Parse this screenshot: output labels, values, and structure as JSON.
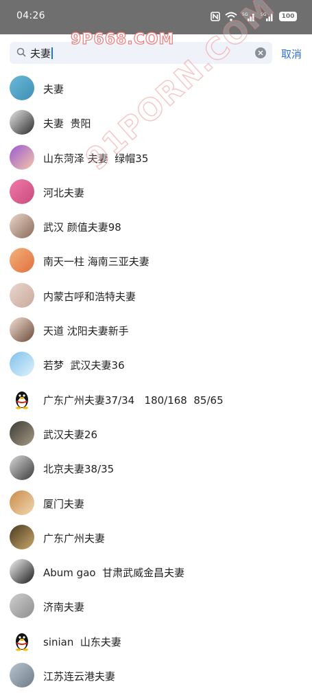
{
  "status_bar": {
    "time": "04:26",
    "battery": "100"
  },
  "watermarks": {
    "top": "9P668.COM",
    "diagonal": "91PORN.COM"
  },
  "search": {
    "query": "夫妻",
    "cancel_label": "取消"
  },
  "results": [
    {
      "name": "夫妻",
      "avatar": "photo-sea",
      "colors": [
        "#6ab9d8",
        "#3f8fb5"
      ]
    },
    {
      "name": "夫妻  贵阳",
      "avatar": "photo-dark",
      "colors": [
        "#e6e6e6",
        "#2b2b2b"
      ]
    },
    {
      "name": "山东菏泽 夫妻  绿帽35",
      "avatar": "photo-cartoon",
      "colors": [
        "#9b59d0",
        "#f4c7a8"
      ]
    },
    {
      "name": "河北夫妻",
      "avatar": "photo-pink",
      "colors": [
        "#f07aa8",
        "#c94b7d"
      ]
    },
    {
      "name": "武汉 颜值夫妻98",
      "avatar": "photo-face",
      "colors": [
        "#e9d6c8",
        "#8a6a58"
      ]
    },
    {
      "name": "南天一柱 海南三亚夫妻",
      "avatar": "photo-fingers",
      "colors": [
        "#f3b27a",
        "#e07040"
      ]
    },
    {
      "name": "内蒙古呼和浩特夫妻",
      "avatar": "photo-skin",
      "colors": [
        "#ead6cf",
        "#c9a89a"
      ]
    },
    {
      "name": "天道 沈阳夫妻新手",
      "avatar": "photo-girl",
      "colors": [
        "#f2e0d4",
        "#6b4a3a"
      ]
    },
    {
      "name": "若梦  武汉夫妻36",
      "avatar": "photo-sky",
      "colors": [
        "#7fc2ec",
        "#dff1fb"
      ]
    },
    {
      "name": "广东广州夫妻37/34   180/168  85/65",
      "avatar": "penguin-icon",
      "colors": [
        "#ffffff",
        "#111111"
      ]
    },
    {
      "name": "武汉夫妻26",
      "avatar": "photo-hair",
      "colors": [
        "#3b3b34",
        "#a89a86"
      ]
    },
    {
      "name": "北京夫妻38/35",
      "avatar": "photo-bw",
      "colors": [
        "#d9d9d9",
        "#3a3a3a"
      ]
    },
    {
      "name": "厦门夫妻",
      "avatar": "photo-dog",
      "colors": [
        "#c98a4a",
        "#f1d8b0"
      ]
    },
    {
      "name": "广东广州夫妻",
      "avatar": "photo-gold",
      "colors": [
        "#4a3a22",
        "#caa86a"
      ]
    },
    {
      "name": "Abum gao  甘肃武威金昌夫妻",
      "avatar": "photo-panda",
      "colors": [
        "#f4f4f4",
        "#1a1a1a"
      ]
    },
    {
      "name": "济南夫妻",
      "avatar": "photo-phone",
      "colors": [
        "#cfcfcf",
        "#8d8d8d"
      ]
    },
    {
      "name": "sinian  山东夫妻",
      "avatar": "penguin-icon",
      "colors": [
        "#ffffff",
        "#111111"
      ]
    },
    {
      "name": "江苏连云港夫妻",
      "avatar": "photo-crowd",
      "colors": [
        "#b9c4cf",
        "#6e7b86"
      ]
    }
  ]
}
